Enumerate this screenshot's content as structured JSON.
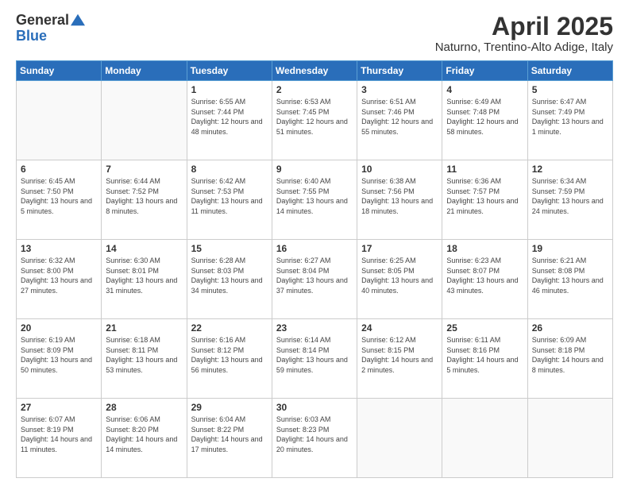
{
  "logo": {
    "text_general": "General",
    "text_blue": "Blue"
  },
  "title": {
    "month_year": "April 2025",
    "location": "Naturno, Trentino-Alto Adige, Italy"
  },
  "headers": [
    "Sunday",
    "Monday",
    "Tuesday",
    "Wednesday",
    "Thursday",
    "Friday",
    "Saturday"
  ],
  "weeks": [
    [
      {
        "day": "",
        "info": ""
      },
      {
        "day": "",
        "info": ""
      },
      {
        "day": "1",
        "info": "Sunrise: 6:55 AM\nSunset: 7:44 PM\nDaylight: 12 hours and 48 minutes."
      },
      {
        "day": "2",
        "info": "Sunrise: 6:53 AM\nSunset: 7:45 PM\nDaylight: 12 hours and 51 minutes."
      },
      {
        "day": "3",
        "info": "Sunrise: 6:51 AM\nSunset: 7:46 PM\nDaylight: 12 hours and 55 minutes."
      },
      {
        "day": "4",
        "info": "Sunrise: 6:49 AM\nSunset: 7:48 PM\nDaylight: 12 hours and 58 minutes."
      },
      {
        "day": "5",
        "info": "Sunrise: 6:47 AM\nSunset: 7:49 PM\nDaylight: 13 hours and 1 minute."
      }
    ],
    [
      {
        "day": "6",
        "info": "Sunrise: 6:45 AM\nSunset: 7:50 PM\nDaylight: 13 hours and 5 minutes."
      },
      {
        "day": "7",
        "info": "Sunrise: 6:44 AM\nSunset: 7:52 PM\nDaylight: 13 hours and 8 minutes."
      },
      {
        "day": "8",
        "info": "Sunrise: 6:42 AM\nSunset: 7:53 PM\nDaylight: 13 hours and 11 minutes."
      },
      {
        "day": "9",
        "info": "Sunrise: 6:40 AM\nSunset: 7:55 PM\nDaylight: 13 hours and 14 minutes."
      },
      {
        "day": "10",
        "info": "Sunrise: 6:38 AM\nSunset: 7:56 PM\nDaylight: 13 hours and 18 minutes."
      },
      {
        "day": "11",
        "info": "Sunrise: 6:36 AM\nSunset: 7:57 PM\nDaylight: 13 hours and 21 minutes."
      },
      {
        "day": "12",
        "info": "Sunrise: 6:34 AM\nSunset: 7:59 PM\nDaylight: 13 hours and 24 minutes."
      }
    ],
    [
      {
        "day": "13",
        "info": "Sunrise: 6:32 AM\nSunset: 8:00 PM\nDaylight: 13 hours and 27 minutes."
      },
      {
        "day": "14",
        "info": "Sunrise: 6:30 AM\nSunset: 8:01 PM\nDaylight: 13 hours and 31 minutes."
      },
      {
        "day": "15",
        "info": "Sunrise: 6:28 AM\nSunset: 8:03 PM\nDaylight: 13 hours and 34 minutes."
      },
      {
        "day": "16",
        "info": "Sunrise: 6:27 AM\nSunset: 8:04 PM\nDaylight: 13 hours and 37 minutes."
      },
      {
        "day": "17",
        "info": "Sunrise: 6:25 AM\nSunset: 8:05 PM\nDaylight: 13 hours and 40 minutes."
      },
      {
        "day": "18",
        "info": "Sunrise: 6:23 AM\nSunset: 8:07 PM\nDaylight: 13 hours and 43 minutes."
      },
      {
        "day": "19",
        "info": "Sunrise: 6:21 AM\nSunset: 8:08 PM\nDaylight: 13 hours and 46 minutes."
      }
    ],
    [
      {
        "day": "20",
        "info": "Sunrise: 6:19 AM\nSunset: 8:09 PM\nDaylight: 13 hours and 50 minutes."
      },
      {
        "day": "21",
        "info": "Sunrise: 6:18 AM\nSunset: 8:11 PM\nDaylight: 13 hours and 53 minutes."
      },
      {
        "day": "22",
        "info": "Sunrise: 6:16 AM\nSunset: 8:12 PM\nDaylight: 13 hours and 56 minutes."
      },
      {
        "day": "23",
        "info": "Sunrise: 6:14 AM\nSunset: 8:14 PM\nDaylight: 13 hours and 59 minutes."
      },
      {
        "day": "24",
        "info": "Sunrise: 6:12 AM\nSunset: 8:15 PM\nDaylight: 14 hours and 2 minutes."
      },
      {
        "day": "25",
        "info": "Sunrise: 6:11 AM\nSunset: 8:16 PM\nDaylight: 14 hours and 5 minutes."
      },
      {
        "day": "26",
        "info": "Sunrise: 6:09 AM\nSunset: 8:18 PM\nDaylight: 14 hours and 8 minutes."
      }
    ],
    [
      {
        "day": "27",
        "info": "Sunrise: 6:07 AM\nSunset: 8:19 PM\nDaylight: 14 hours and 11 minutes."
      },
      {
        "day": "28",
        "info": "Sunrise: 6:06 AM\nSunset: 8:20 PM\nDaylight: 14 hours and 14 minutes."
      },
      {
        "day": "29",
        "info": "Sunrise: 6:04 AM\nSunset: 8:22 PM\nDaylight: 14 hours and 17 minutes."
      },
      {
        "day": "30",
        "info": "Sunrise: 6:03 AM\nSunset: 8:23 PM\nDaylight: 14 hours and 20 minutes."
      },
      {
        "day": "",
        "info": ""
      },
      {
        "day": "",
        "info": ""
      },
      {
        "day": "",
        "info": ""
      }
    ]
  ]
}
